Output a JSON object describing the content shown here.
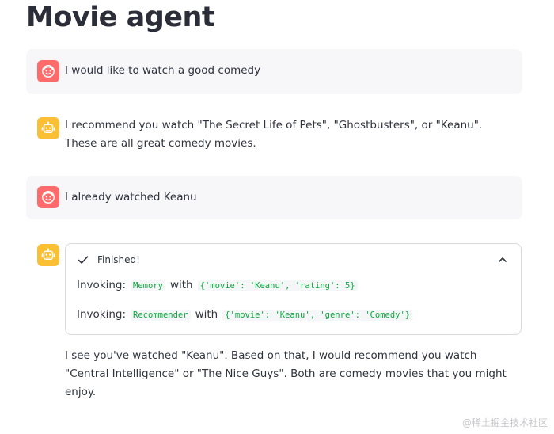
{
  "page": {
    "title": "Movie agent"
  },
  "messages": [
    {
      "role": "user",
      "text": "I would like to watch a good comedy"
    },
    {
      "role": "assistant",
      "text": "I recommend you watch \"The Secret Life of Pets\", \"Ghostbusters\", or \"Keanu\". These are all great comedy movies."
    },
    {
      "role": "user",
      "text": "I already watched Keanu"
    },
    {
      "role": "assistant",
      "status": {
        "label": "Finished!",
        "steps": [
          {
            "prefix": "Invoking:",
            "tool": "Memory",
            "with": "with",
            "args": "{'movie': 'Keanu', 'rating': 5}"
          },
          {
            "prefix": "Invoking:",
            "tool": "Recommender",
            "with": "with",
            "args": "{'movie': 'Keanu', 'genre': 'Comedy'}"
          }
        ]
      },
      "text": "I see you've watched \"Keanu\". Based on that, I would recommend you watch \"Central Intelligence\" or \"The Nice Guys\". Both are comedy movies that you might enjoy."
    }
  ],
  "watermark": "@稀土掘金技术社区",
  "colors": {
    "user_avatar": "#ff6b6b",
    "bot_avatar": "#fbbf36",
    "code_text": "#09ab3b"
  },
  "icons": {
    "user_avatar": "smiling-face-icon",
    "bot_avatar": "robot-icon",
    "status": "check-icon",
    "collapse": "chevron-up-icon"
  }
}
